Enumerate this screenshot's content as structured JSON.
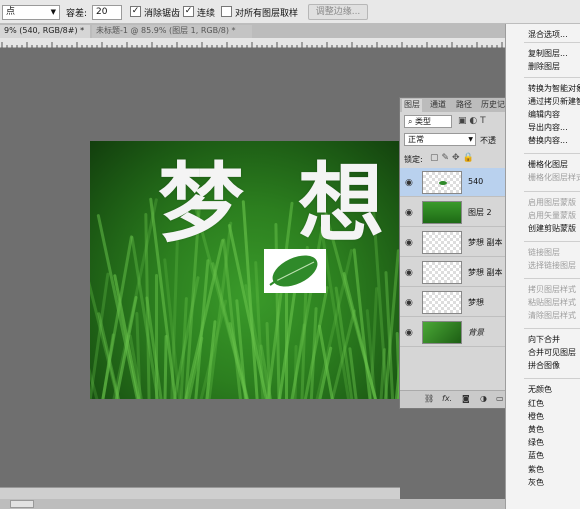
{
  "options_bar": {
    "sample_value": "点",
    "tolerance_label": "容差:",
    "tolerance_value": "20",
    "antialias_label": "消除锯齿",
    "contiguous_label": "连续",
    "all_layers_label": "对所有图层取样",
    "refine_edge_label": "调整边缘..."
  },
  "doc_tabs": [
    {
      "label": "9% (540, RGB/8#) *"
    },
    {
      "label": "未标题-1 @ 85.9% (图层 1, RGB/8) *"
    }
  ],
  "canvas": {
    "char1": "梦",
    "char2": "想"
  },
  "layers_panel": {
    "tabs": [
      "图层",
      "通道",
      "路径",
      "历史记"
    ],
    "filter_value": "类型",
    "blend_mode": "正常",
    "opacity_label": "不透",
    "lock_label": "锁定:",
    "layers": [
      {
        "name": "540",
        "active": true
      },
      {
        "name": "图层 2",
        "active": false
      },
      {
        "name": "梦想 副本",
        "active": false
      },
      {
        "name": "梦想 副本",
        "active": false
      },
      {
        "name": "梦想",
        "active": false
      },
      {
        "name": "背景",
        "active": false
      }
    ],
    "footer_icons": [
      "link-icon",
      "fx-icon",
      "mask-icon",
      "adjustment-icon"
    ],
    "footer_fx_label": "fx."
  },
  "context_menu": {
    "items": [
      {
        "label": "混合选项...",
        "enabled": true
      },
      {
        "label": "复制图层...",
        "enabled": true
      },
      {
        "label": "删除图层",
        "enabled": true
      },
      {
        "label": "转换为智能对象",
        "enabled": true
      },
      {
        "label": "通过拷贝新建智",
        "enabled": true
      },
      {
        "label": "编辑内容",
        "enabled": true
      },
      {
        "label": "导出内容...",
        "enabled": true
      },
      {
        "label": "替换内容...",
        "enabled": true
      },
      {
        "label": "栅格化图层",
        "enabled": true
      },
      {
        "label": "栅格化图层样式",
        "enabled": false
      },
      {
        "label": "启用图层蒙版",
        "enabled": false
      },
      {
        "label": "启用矢量蒙版",
        "enabled": false
      },
      {
        "label": "创建剪贴蒙版",
        "enabled": true
      },
      {
        "label": "链接图层",
        "enabled": false
      },
      {
        "label": "选择链接图层",
        "enabled": false
      },
      {
        "label": "拷贝图层样式",
        "enabled": false
      },
      {
        "label": "粘贴图层样式",
        "enabled": false
      },
      {
        "label": "清除图层样式",
        "enabled": false
      },
      {
        "label": "向下合并",
        "enabled": true
      },
      {
        "label": "合并可见图层",
        "enabled": true
      },
      {
        "label": "拼合图像",
        "enabled": true
      },
      {
        "label": "无颜色",
        "enabled": true
      },
      {
        "label": "红色",
        "enabled": true
      },
      {
        "label": "橙色",
        "enabled": true
      },
      {
        "label": "黄色",
        "enabled": true
      },
      {
        "label": "绿色",
        "enabled": true
      },
      {
        "label": "蓝色",
        "enabled": true
      },
      {
        "label": "紫色",
        "enabled": true
      },
      {
        "label": "灰色",
        "enabled": true
      }
    ]
  },
  "colors": {
    "active_layer": "#b9d1ee",
    "grass_dark": "#1c5a14",
    "grass_light": "#3a9a2a"
  }
}
